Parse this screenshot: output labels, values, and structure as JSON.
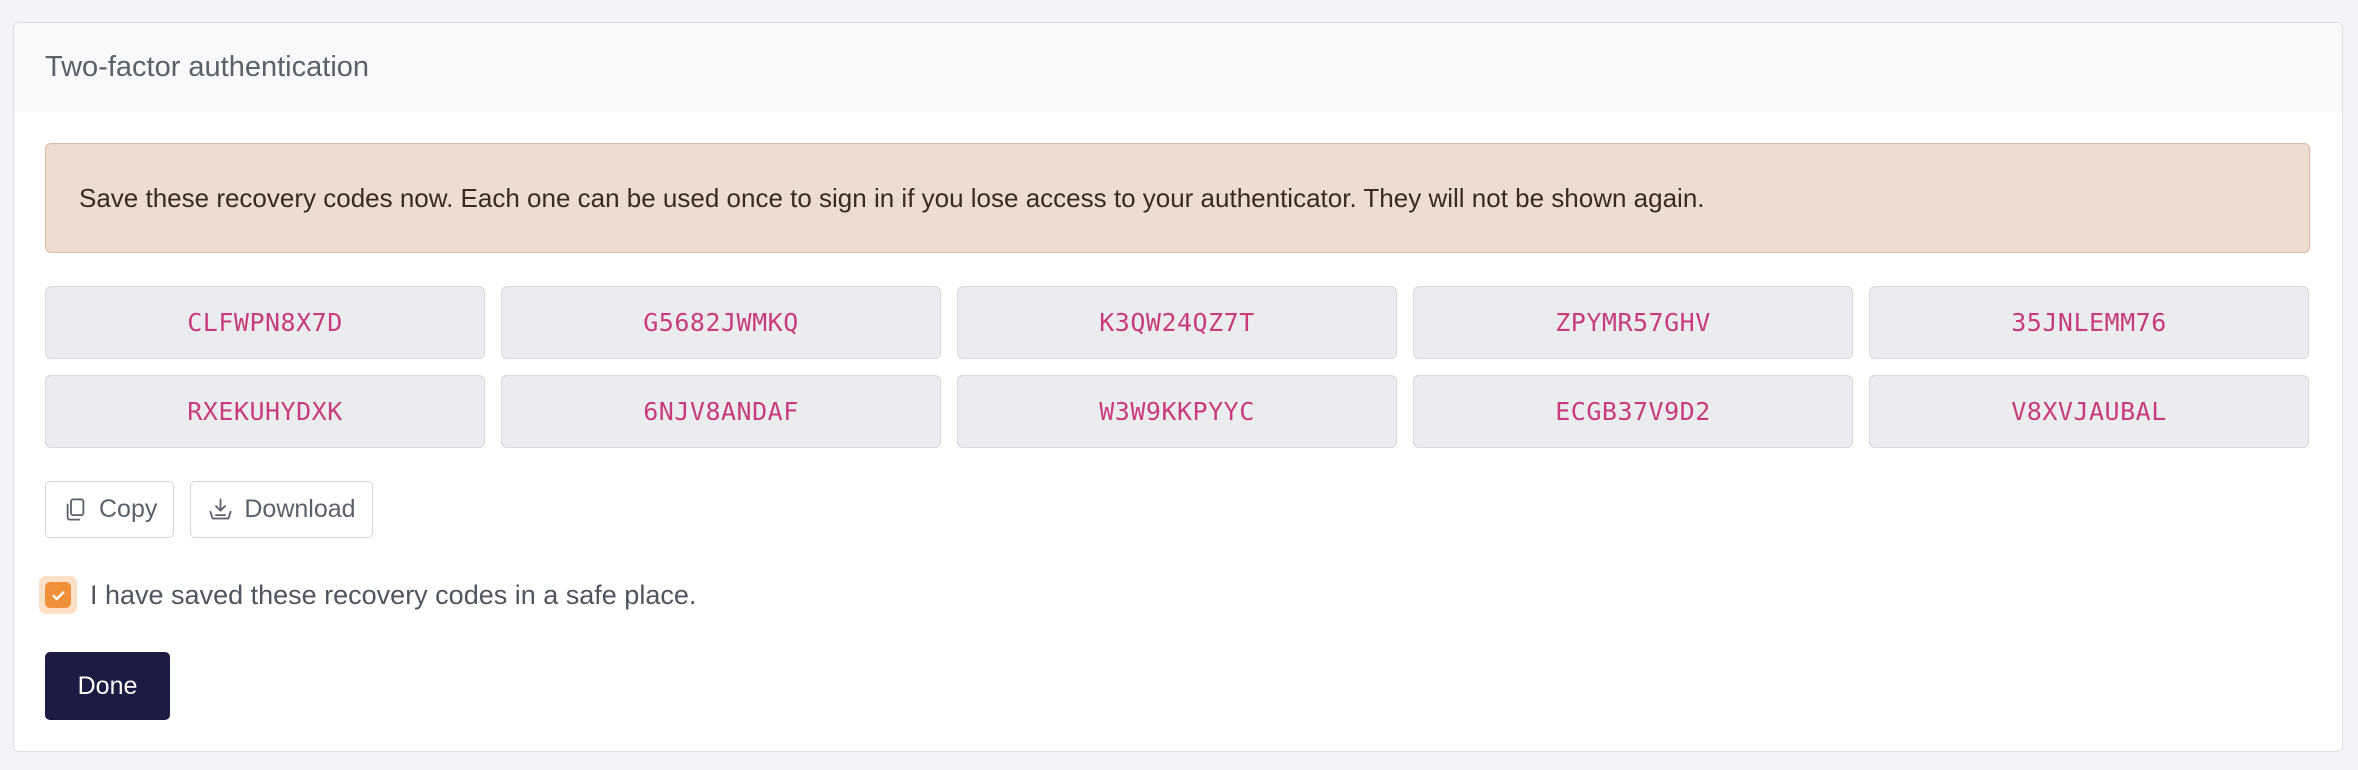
{
  "card": {
    "title": "Two-factor authentication"
  },
  "alert": {
    "message": "Save these recovery codes now. Each one can be used once to sign in if you lose access to your authenticator. They will not be shown again."
  },
  "codes": [
    "CLFWPN8X7D",
    "G5682JWMKQ",
    "K3QW24QZ7T",
    "ZPYMR57GHV",
    "35JNLEMM76",
    "RXEKUHYDXK",
    "6NJV8ANDAF",
    "W3W9KKPYYC",
    "ECGB37V9D2",
    "V8XVJAUBAL"
  ],
  "actions": {
    "copy_label": "Copy",
    "download_label": "Download"
  },
  "confirm": {
    "label": "I have saved these recovery codes in a safe place.",
    "checked": true
  },
  "done_label": "Done",
  "colors": {
    "accent": "#f0913a",
    "code_text": "#c93c7b",
    "primary_button": "#1c1b42",
    "alert_bg": "#eddcd0"
  },
  "icons": {
    "copy": "copy-icon",
    "download": "download-icon",
    "check": "check-icon"
  }
}
